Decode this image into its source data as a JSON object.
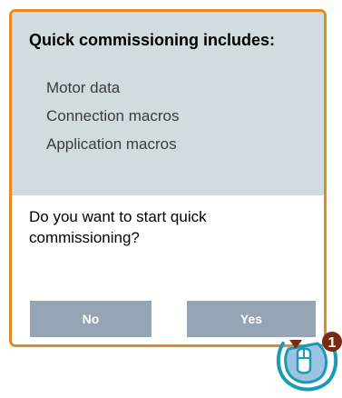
{
  "dialog": {
    "info_title": "Quick commissioning includes:",
    "info_items": [
      {
        "label": "Motor data"
      },
      {
        "label": "Connection macros"
      },
      {
        "label": "Application macros"
      }
    ],
    "question": "Do you want to start quick commissioning?",
    "no_label": "No",
    "yes_label": "Yes"
  },
  "callout": {
    "number": "1",
    "icon": "press-knob-icon"
  },
  "colors": {
    "border_accent": "#e8891f",
    "info_background": "#d2dbe0",
    "button_background": "#96a5b3",
    "callout_badge": "#7a2a12",
    "knob_fill": "#9cc3e2"
  }
}
